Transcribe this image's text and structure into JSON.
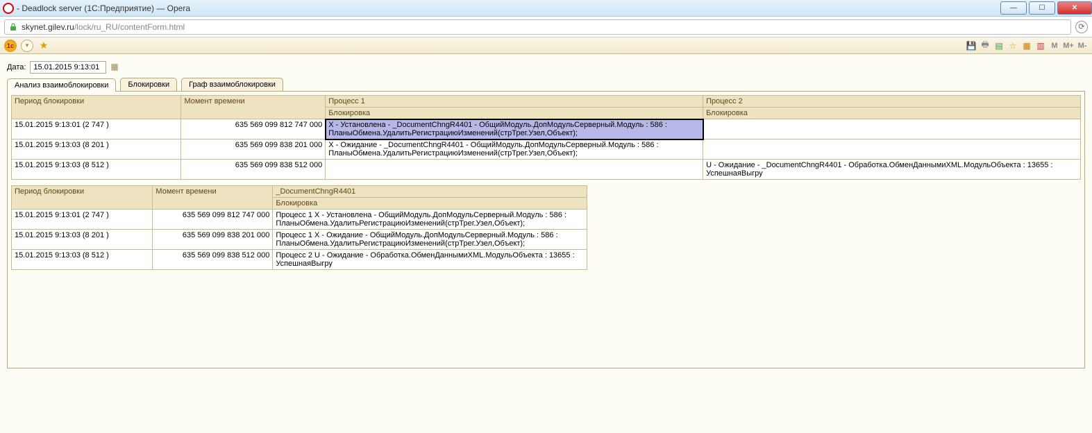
{
  "window": {
    "title": " - Deadlock server (1С:Предприятие) — Opera"
  },
  "address": {
    "host": "skynet.gilev.ru",
    "path": "/lock/ru_RU/contentForm.html"
  },
  "toolbar": {
    "m": "M",
    "m_plus": "M+",
    "m_minus": "M-"
  },
  "form": {
    "date_label": "Дата:",
    "date_value": "15.01.2015 9:13:01"
  },
  "tabs": [
    {
      "label": "Анализ взаимоблокировки",
      "active": true
    },
    {
      "label": "Блокировки",
      "active": false
    },
    {
      "label": "Граф взаимоблокировки",
      "active": false
    }
  ],
  "table1": {
    "headers": {
      "period": "Период блокировки",
      "moment": "Момент времени",
      "proc1": "Процесс 1",
      "proc2": "Процесс 2",
      "lock": "Блокировка"
    },
    "rows": [
      {
        "period": "15.01.2015 9:13:01 (2 747 )",
        "moment": "635 569 099 812 747 000",
        "proc1": "X - Установлена - _DocumentChngR4401 - ОбщийМодуль.ДопМодульСерверный.Модуль : 586 : ПланыОбмена.УдалитьРегистрациюИзменений(стрТрег.Узел,Объект);",
        "proc2": "",
        "sel": true
      },
      {
        "period": "15.01.2015 9:13:03 (8 201 )",
        "moment": "635 569 099 838 201 000",
        "proc1": "X - Ожидание - _DocumentChngR4401 - ОбщийМодуль.ДопМодульСерверный.Модуль : 586 : ПланыОбмена.УдалитьРегистрациюИзменений(стрТрег.Узел,Объект);",
        "proc2": ""
      },
      {
        "period": "15.01.2015 9:13:03 (8 512 )",
        "moment": "635 569 099 838 512 000",
        "proc1": "",
        "proc2": "U - Ожидание - _DocumentChngR4401 - Обработка.ОбменДаннымиXML.МодульОбъекта : 13655 : УспешнаяВыгру"
      }
    ]
  },
  "table2": {
    "headers": {
      "period": "Период блокировки",
      "moment": "Момент времени",
      "doc": "_DocumentChngR4401",
      "lock": "Блокировка"
    },
    "rows": [
      {
        "period": "15.01.2015 9:13:01 (2 747 )",
        "moment": "635 569 099 812 747 000",
        "text": "Процесс 1 X - Установлена - ОбщийМодуль.ДопМодульСерверный.Модуль : 586 : ПланыОбмена.УдалитьРегистрациюИзменений(стрТрег.Узел,Объект);"
      },
      {
        "period": "15.01.2015 9:13:03 (8 201 )",
        "moment": "635 569 099 838 201 000",
        "text": "Процесс 1 X - Ожидание - ОбщийМодуль.ДопМодульСерверный.Модуль : 586 : ПланыОбмена.УдалитьРегистрациюИзменений(стрТрег.Узел,Объект);"
      },
      {
        "period": "15.01.2015 9:13:03 (8 512 )",
        "moment": "635 569 099 838 512 000",
        "text": "Процесс 2 U - Ожидание - Обработка.ОбменДаннымиXML.МодульОбъекта : 13655 : УспешнаяВыгру"
      }
    ]
  }
}
